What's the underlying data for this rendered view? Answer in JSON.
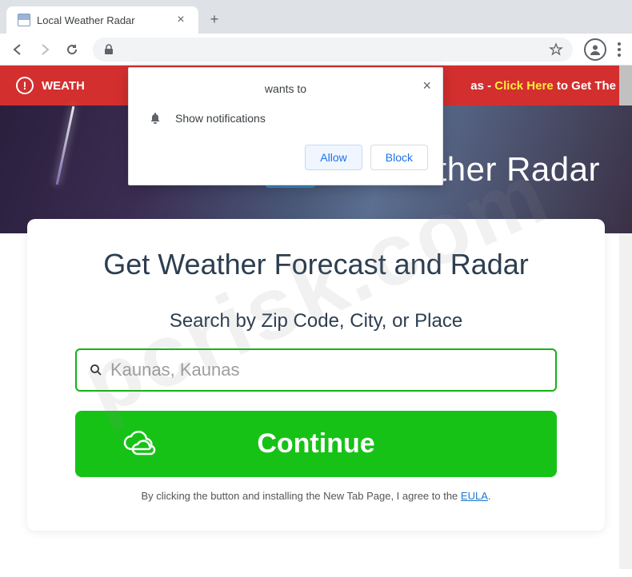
{
  "tab": {
    "title": "Local Weather Radar"
  },
  "alert": {
    "prefix": "WEATH",
    "suffix": "as - ",
    "link": "Click Here",
    "tail": " to Get The"
  },
  "hero": {
    "title": "ather Radar"
  },
  "card": {
    "title": "Get Weather Forecast and Radar",
    "search_label": "Search by Zip Code, City, or Place",
    "search_value": "Kaunas, Kaunas",
    "continue_label": "Continue",
    "disclaimer_prefix": "By clicking the button and installing the New Tab Page, I agree to the ",
    "eula_label": "EULA",
    "disclaimer_suffix": "."
  },
  "notification": {
    "title": "wants to",
    "text": "Show notifications",
    "allow_label": "Allow",
    "block_label": "Block"
  },
  "watermark": "pcrisk.com"
}
